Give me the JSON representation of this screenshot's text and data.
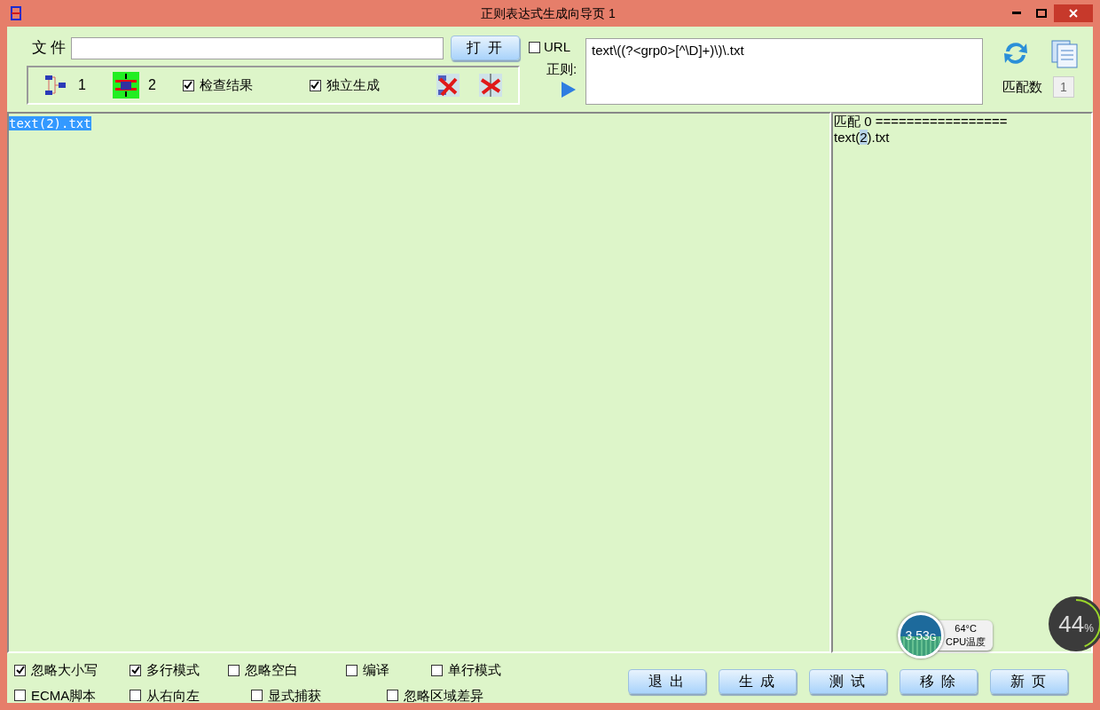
{
  "window": {
    "title": "正则表达式生成向导页 1"
  },
  "file": {
    "label": "文 件",
    "button": "打 开"
  },
  "toolbar": {
    "modes": [
      {
        "label": "1",
        "selected": false
      },
      {
        "label": "2",
        "selected": true
      }
    ],
    "checkboxes": [
      {
        "label": "检查结果",
        "checked": true
      },
      {
        "label": "独立生成",
        "checked": true
      }
    ]
  },
  "url": {
    "label": "URL",
    "checked": false
  },
  "regex": {
    "label": "正则:",
    "value": "text\\((?<grp0>[^\\D]+)\\)\\.txt"
  },
  "match_count": {
    "label": "匹配数",
    "value": "1"
  },
  "input_text": {
    "text": "text(2).txt",
    "selected": true
  },
  "results": {
    "header": "匹配 0 =================",
    "lines": [
      {
        "before": "text(",
        "match": "2",
        "after": ").txt"
      }
    ]
  },
  "options": [
    {
      "label": "忽略大小写",
      "checked": true
    },
    {
      "label": "多行模式",
      "checked": true
    },
    {
      "label": "忽略空白",
      "checked": false
    },
    {
      "label": "编译",
      "checked": false
    },
    {
      "label": "单行模式",
      "checked": false
    },
    {
      "label": "ECMA脚本",
      "checked": false
    },
    {
      "label": "从右向左",
      "checked": false
    },
    {
      "label": "显式捕获",
      "checked": false
    },
    {
      "label": "忽略区域差异",
      "checked": false
    }
  ],
  "buttons": [
    "退 出",
    "生 成",
    "测 试",
    "移 除",
    "新 页"
  ],
  "cpu_widget": {
    "speed": "3.53",
    "unit": "G",
    "temperature": "64°C",
    "label": "CPU温度"
  },
  "usage_widget": {
    "value": "44",
    "unit": "%",
    "level": 0.44
  }
}
